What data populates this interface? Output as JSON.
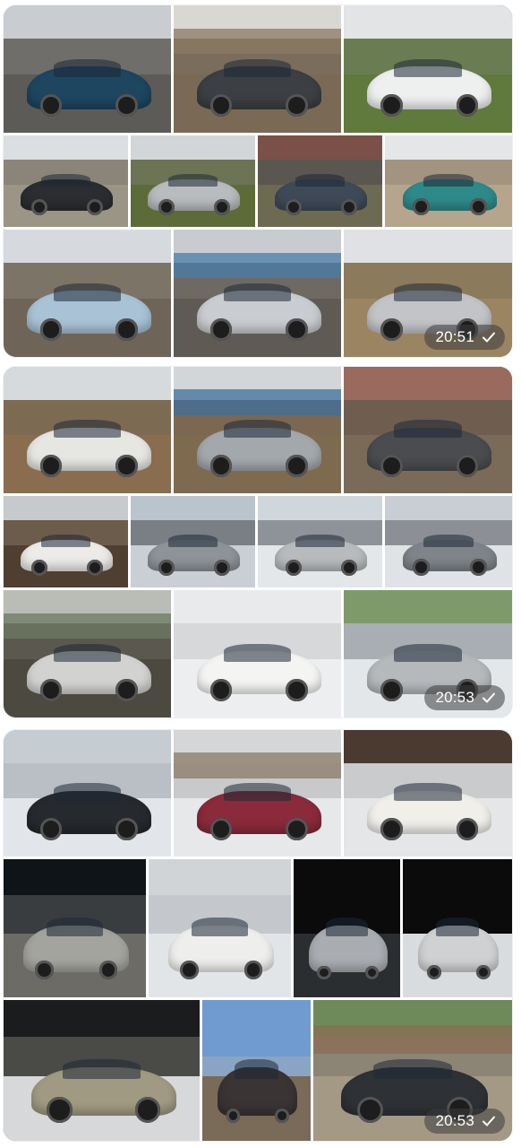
{
  "albums": [
    {
      "time": "20:51",
      "status_icon": "read-check-icon"
    },
    {
      "time": "20:53",
      "status_icon": "read-check-icon"
    },
    {
      "time": "20:53",
      "status_icon": "read-check-icon"
    }
  ],
  "colors": {
    "bubble_background": "#ffffff",
    "timestamp_pill": "#3c3c3c",
    "timestamp_text": "#ffffff"
  }
}
